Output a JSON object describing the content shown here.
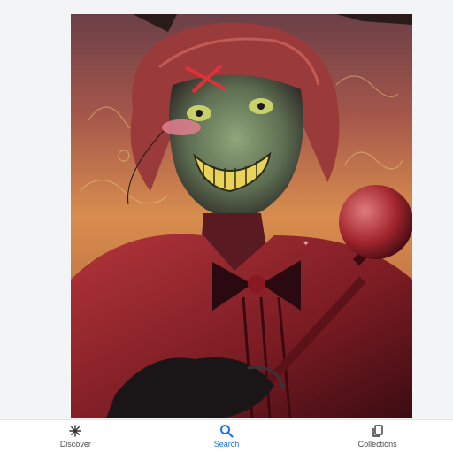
{
  "image": {
    "subject": "illustrated portrait artwork"
  },
  "bottom_nav": {
    "items": [
      {
        "label": "Discover",
        "icon": "asterisk-icon",
        "active": false
      },
      {
        "label": "Search",
        "icon": "search-icon",
        "active": true
      },
      {
        "label": "Collections",
        "icon": "collections-icon",
        "active": false
      }
    ]
  },
  "colors": {
    "accent": "#1a73e8",
    "nav_text": "#4a4a4a",
    "viewer_bg": "#f3f4f5"
  }
}
